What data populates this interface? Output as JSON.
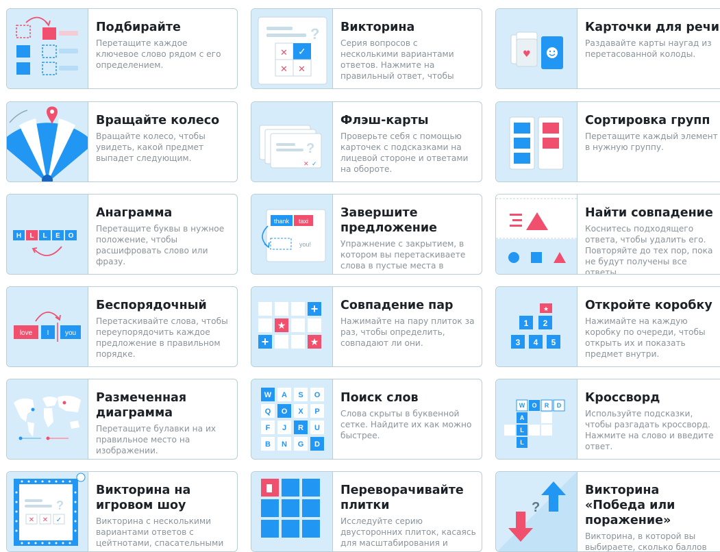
{
  "cards": [
    {
      "title": "Подбирайте",
      "desc": "Перетащите каждое ключевое слово рядом с его определением.",
      "icon": "match-up-icon"
    },
    {
      "title": "Викторина",
      "desc": "Серия вопросов с несколькими вариантами ответов. Нажмите на правильный ответ, чтобы",
      "icon": "quiz-icon"
    },
    {
      "title": "Карточки для речи",
      "desc": "Раздавайте карты наугад из перетасованной колоды.",
      "icon": "speaking-cards-icon"
    },
    {
      "title": "Вращайте колесо",
      "desc": "Вращайте колесо, чтобы увидеть, какой предмет выпадет следующим.",
      "icon": "spin-wheel-icon"
    },
    {
      "title": "Флэш-карты",
      "desc": "Проверьте себя с помощью карточек с подсказками на лицевой стороне и ответами на обороте.",
      "icon": "flash-cards-icon"
    },
    {
      "title": "Сортировка групп",
      "desc": "Перетащите каждый элемент в нужную группу.",
      "icon": "group-sort-icon"
    },
    {
      "title": "Анаграмма",
      "desc": "Перетащите буквы в нужное положение, чтобы расшифровать слово или фразу.",
      "icon": "anagram-icon",
      "letters": [
        "H",
        "L",
        "L",
        "E",
        "O"
      ]
    },
    {
      "title": "Завершите предложение",
      "desc": "Упражнение с закрытием, в котором вы перетаскиваете слова в пустые места в тексте.",
      "icon": "complete-sentence-icon",
      "words": [
        "thank",
        "taxi",
        "you!"
      ]
    },
    {
      "title": "Найти совпадение",
      "desc": "Коснитесь подходящего ответа, чтобы удалить его. Повторяйте до тех пор, пока не будут получены все ответы.",
      "icon": "find-match-icon"
    },
    {
      "title": "Беспорядочный",
      "desc": "Перетаскивайте слова, чтобы переупорядочить каждое предложение в правильном порядке.",
      "icon": "unjumble-icon",
      "words": [
        "love",
        "I",
        "you"
      ]
    },
    {
      "title": "Совпадение пар",
      "desc": "Нажимайте на пару плиток за раз, чтобы определить, совпадают ли они.",
      "icon": "matching-pairs-icon"
    },
    {
      "title": "Откройте коробку",
      "desc": "Нажимайте на каждую коробку по очереди, чтобы открыть их и показать предмет внутри.",
      "icon": "open-box-icon",
      "numbers": [
        "1",
        "2",
        "3",
        "4",
        "5"
      ]
    },
    {
      "title": "Размеченная диаграмма",
      "desc": "Перетащите булавки на их правильное место на изображении.",
      "icon": "labelled-diagram-icon"
    },
    {
      "title": "Поиск слов",
      "desc": "Слова скрыты в буквенной сетке. Найдите их как можно быстрее.",
      "icon": "wordsearch-icon",
      "letters": [
        "W",
        "A",
        "S",
        "O",
        "Q",
        "O",
        "X",
        "P",
        "F",
        "J",
        "R",
        "U",
        "B",
        "N",
        "G",
        "D"
      ]
    },
    {
      "title": "Кроссворд",
      "desc": "Используйте подсказки, чтобы разгадать кроссворд. Нажмите на слово и введите ответ.",
      "icon": "crossword-icon",
      "letters": [
        "W",
        "O",
        "R",
        "D",
        "A",
        "L",
        "L"
      ]
    },
    {
      "title": "Викторина на игровом шоу",
      "desc": "Викторина с несколькими вариантами ответов с цейтнотами, спасательными",
      "icon": "gameshow-quiz-icon"
    },
    {
      "title": "Переворачивайте плитки",
      "desc": "Исследуйте серию двусторонних плиток, касаясь для масштабирования и",
      "icon": "flip-tiles-icon"
    },
    {
      "title": "Викторина «Победа или поражение»",
      "desc": "Викторина, в которой вы выбираете, сколько баллов стоит каждый вопрос.",
      "icon": "win-lose-quiz-icon"
    }
  ]
}
